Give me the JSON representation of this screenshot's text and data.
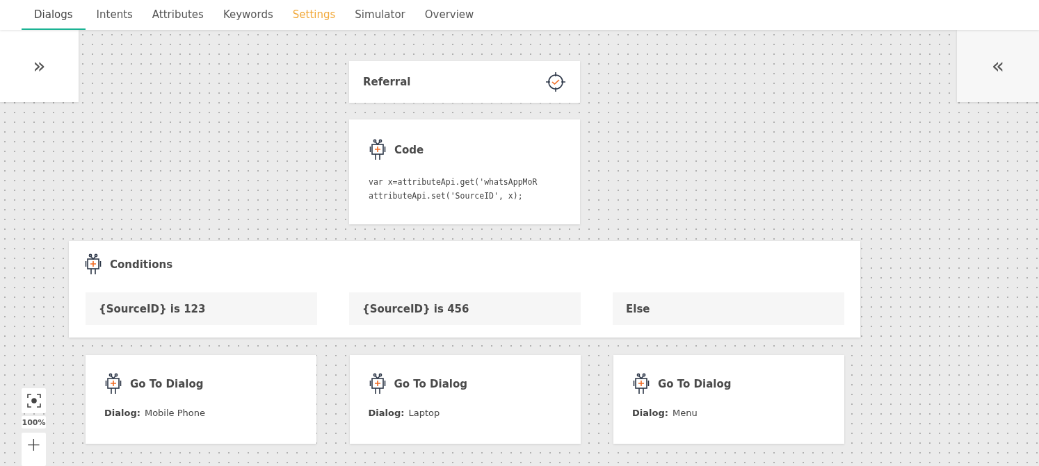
{
  "tabs": [
    {
      "label": "Dialogs",
      "selected": true,
      "highlighted": false
    },
    {
      "label": "Intents",
      "selected": false,
      "highlighted": false
    },
    {
      "label": "Attributes",
      "selected": false,
      "highlighted": false
    },
    {
      "label": "Keywords",
      "selected": false,
      "highlighted": false
    },
    {
      "label": "Settings",
      "selected": false,
      "highlighted": true
    },
    {
      "label": "Simulator",
      "selected": false,
      "highlighted": false
    },
    {
      "label": "Overview",
      "selected": false,
      "highlighted": false
    }
  ],
  "left_panel": {
    "toggle": "»"
  },
  "right_panel": {
    "toggle": "«"
  },
  "referral": {
    "title": "Referral"
  },
  "code": {
    "title": "Code",
    "lines": [
      "var x=attributeApi.get('whatsAppMoR",
      "attributeApi.set('SourceID', x);"
    ]
  },
  "conditions": {
    "title": "Conditions",
    "branches": [
      "{SourceID} is 123",
      "{SourceID} is 456",
      "Else"
    ]
  },
  "goto_cards": [
    {
      "title": "Go To Dialog",
      "label": "Dialog:",
      "value": "Mobile Phone"
    },
    {
      "title": "Go To Dialog",
      "label": "Dialog:",
      "value": "Laptop"
    },
    {
      "title": "Go To Dialog",
      "label": "Dialog:",
      "value": "Menu"
    }
  ],
  "zoom": {
    "level_text": "100%",
    "zoom_in": "+"
  }
}
